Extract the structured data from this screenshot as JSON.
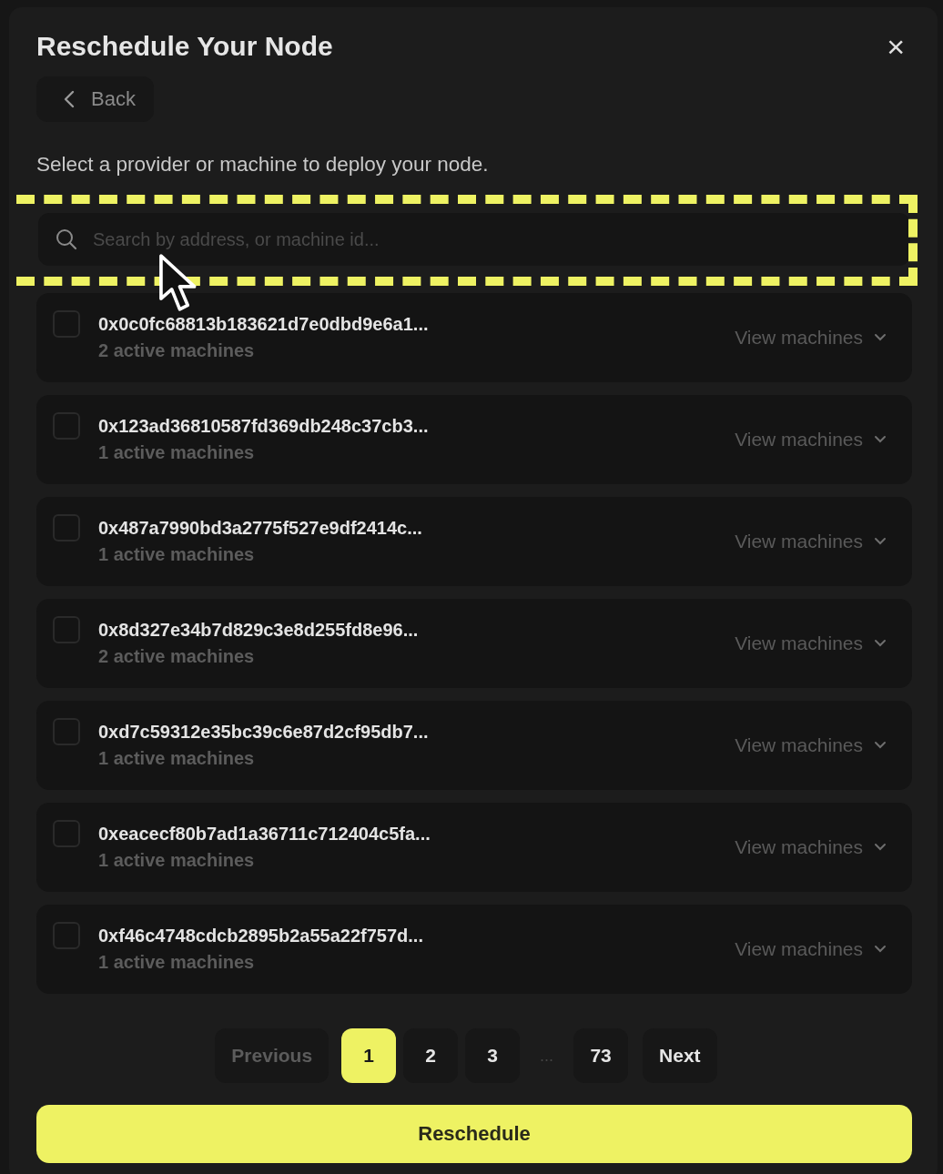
{
  "dialog": {
    "title": "Reschedule Your Node",
    "close": "×"
  },
  "back_button": {
    "label": "Back"
  },
  "instruction": "Select a provider or machine to deploy your node.",
  "search": {
    "placeholder": "Search by address, or machine id..."
  },
  "providers": [
    {
      "address": "0x0c0fc68813b183621d7e0dbd9e6a1...",
      "machines": "2 active machines",
      "checked": false,
      "action": "View machines"
    },
    {
      "address": "0x123ad36810587fd369db248c37cb3...",
      "machines": "1 active machines",
      "checked": false,
      "action": "View machines"
    },
    {
      "address": "0x487a7990bd3a2775f527e9df2414c...",
      "machines": "1 active machines",
      "checked": false,
      "action": "View machines"
    },
    {
      "address": "0x8d327e34b7d829c3e8d255fd8e96...",
      "machines": "2 active machines",
      "checked": false,
      "action": "View machines"
    },
    {
      "address": "0xd7c59312e35bc39c6e87d2cf95db7...",
      "machines": "1 active machines",
      "checked": false,
      "action": "View machines"
    },
    {
      "address": "0xeacecf80b7ad1a36711c712404c5fa...",
      "machines": "1 active machines",
      "checked": false,
      "action": "View machines"
    },
    {
      "address": "0xf46c4748cdcb2895b2a55a22f757d...",
      "machines": "1 active machines",
      "checked": false,
      "action": "View machines"
    }
  ],
  "pagination": {
    "previous": {
      "label": "Previous",
      "disabled": true
    },
    "items": [
      {
        "kind": "page",
        "label": "1",
        "selected": true
      },
      {
        "kind": "page",
        "label": "2",
        "selected": false
      },
      {
        "kind": "page",
        "label": "3",
        "selected": false
      },
      {
        "kind": "ellipsis",
        "label": "..."
      },
      {
        "kind": "page",
        "label": "73",
        "selected": false
      }
    ],
    "next": {
      "label": "Next",
      "disabled": false
    }
  },
  "submit_button": {
    "label": "Reschedule"
  }
}
